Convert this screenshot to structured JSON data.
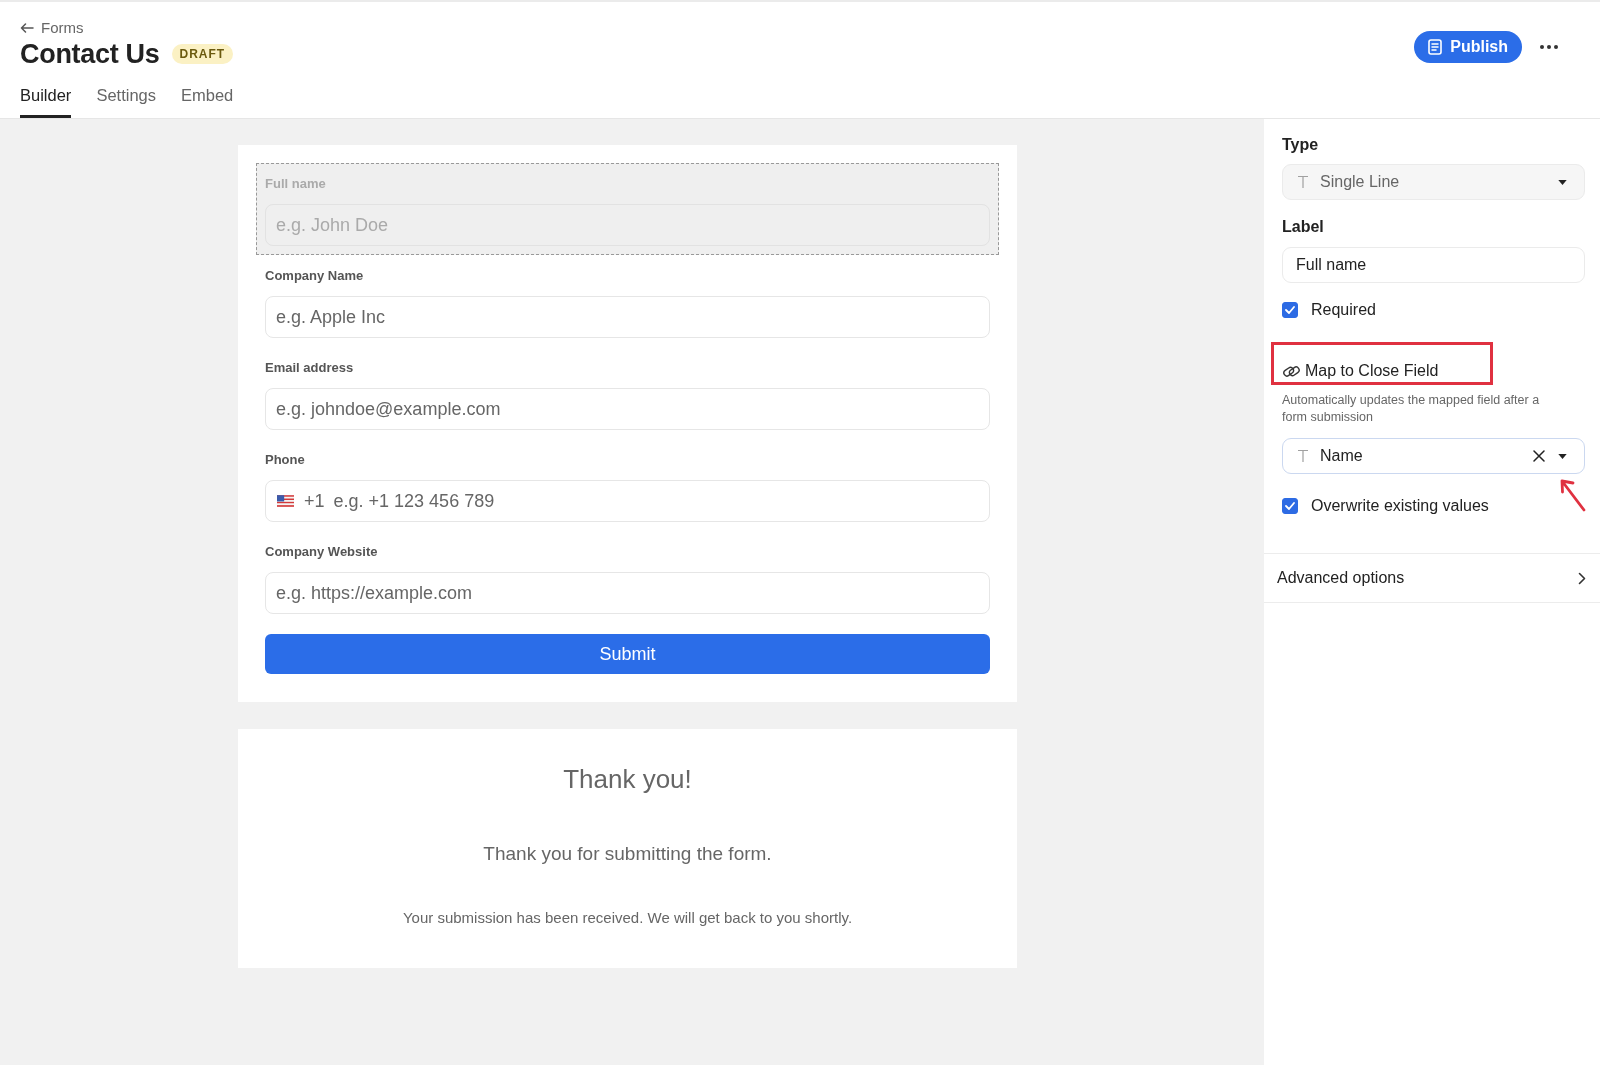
{
  "header": {
    "back_link": "Forms",
    "title": "Contact Us",
    "status_badge": "DRAFT",
    "publish_button": "Publish"
  },
  "tabs": [
    {
      "label": "Builder",
      "selected": true
    },
    {
      "label": "Settings",
      "selected": false
    },
    {
      "label": "Embed",
      "selected": false
    }
  ],
  "form": {
    "fields": [
      {
        "kind": "text",
        "label": "Full name",
        "placeholder": "e.g. John Doe",
        "selected": true
      },
      {
        "kind": "text",
        "label": "Company Name",
        "placeholder": "e.g. Apple Inc",
        "selected": false
      },
      {
        "kind": "text",
        "label": "Email address",
        "placeholder": "e.g. johndoe@example.com",
        "selected": false
      },
      {
        "kind": "phone",
        "label": "Phone",
        "dial_code": "+1",
        "placeholder": "e.g. +1 123 456 789",
        "selected": false
      },
      {
        "kind": "text",
        "label": "Company Website",
        "placeholder": "e.g. https://example.com",
        "selected": false
      }
    ],
    "submit_button": "Submit"
  },
  "thank_you": {
    "title": "Thank you!",
    "message": "Thank you for submitting the form.",
    "note": "Your submission has been received. We will get back to you shortly."
  },
  "field_settings": {
    "type": {
      "label": "Type",
      "value": "Single Line",
      "disabled": true
    },
    "label": {
      "label": "Label",
      "value": "Full name"
    },
    "required": {
      "label": "Required",
      "checked": true
    },
    "map_to_close": {
      "heading": "Map to Close Field",
      "highlighted": true,
      "description": "Automatically updates the mapped field after a form submission",
      "value": "Name",
      "focused": true,
      "pointed_at": true
    },
    "overwrite": {
      "label": "Overwrite existing values",
      "checked": true
    },
    "advanced_options": {
      "label": "Advanced options",
      "expanded": false
    }
  }
}
